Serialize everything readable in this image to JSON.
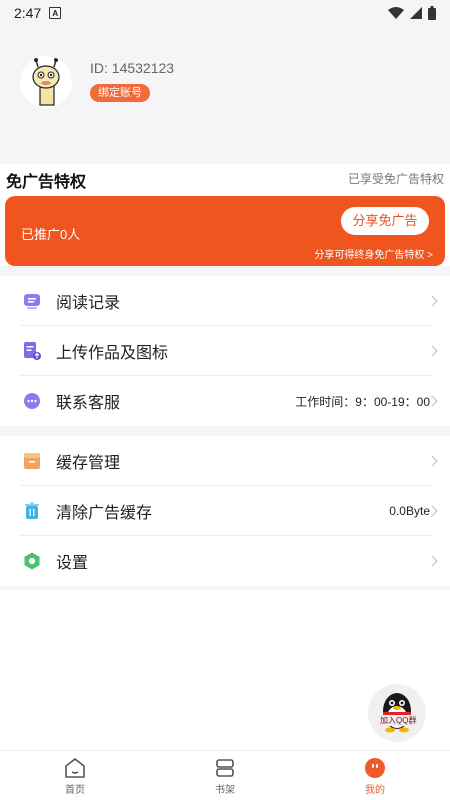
{
  "status_bar": {
    "time": "2:47"
  },
  "profile": {
    "user_id": "ID: 14532123",
    "bind_label": "绑定账号"
  },
  "vip": {
    "title": "免广告特权",
    "status": "已享受免广告特权",
    "promo_count": "已推广0人",
    "share_button": "分享免广告",
    "promo_desc": "分享可得终身免广告特权 >"
  },
  "menu_group_1": [
    {
      "label": "阅读记录",
      "value": ""
    },
    {
      "label": "上传作品及图标",
      "value": ""
    },
    {
      "label": "联系客服",
      "value": "工作时间：9：00-19：00"
    }
  ],
  "menu_group_2": [
    {
      "label": "缓存管理",
      "value": ""
    },
    {
      "label": "清除广告缓存",
      "value": "0.0Byte"
    },
    {
      "label": "设置",
      "value": ""
    }
  ],
  "qq_float": {
    "label": "加入QQ群"
  },
  "tabs": [
    {
      "label": "首页",
      "active": false
    },
    {
      "label": "书架",
      "active": false
    },
    {
      "label": "我的",
      "active": true
    }
  ],
  "colors": {
    "accent": "#f05a28",
    "background": "#f5f5f7"
  }
}
